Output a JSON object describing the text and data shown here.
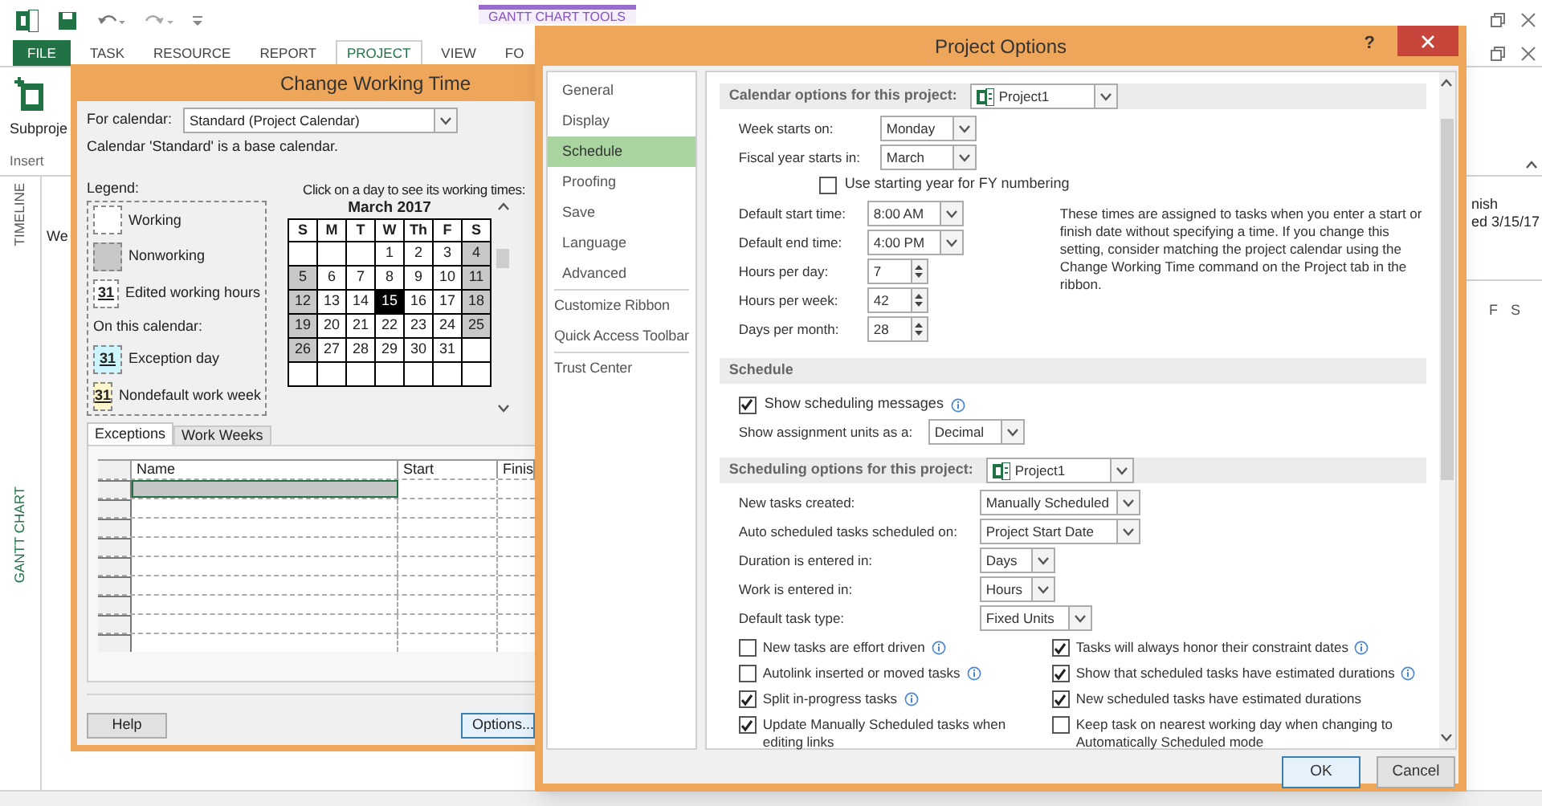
{
  "app": {
    "contextual_tab": "GANTT CHART TOOLS",
    "tabs": [
      {
        "label": "FILE",
        "kind": "file",
        "selected": false
      },
      {
        "label": "TASK",
        "kind": "tab",
        "selected": false
      },
      {
        "label": "RESOURCE",
        "kind": "tab",
        "selected": false
      },
      {
        "label": "REPORT",
        "kind": "tab",
        "selected": false
      },
      {
        "label": "PROJECT",
        "kind": "tab",
        "selected": true
      },
      {
        "label": "VIEW",
        "kind": "tab",
        "selected": false
      },
      {
        "label": "FO",
        "kind": "tab",
        "selected": false
      }
    ],
    "ribbon": {
      "button": "Subproje",
      "group": "Insert"
    },
    "timeline": {
      "label": "TIMELINE",
      "text": "We"
    },
    "view_bar": {
      "label": "GANTT CHART"
    },
    "right_pane": {
      "texts": [
        "nish",
        "ed 3/15/17"
      ],
      "day_headers": [
        "F",
        "S"
      ]
    }
  },
  "change_working_time": {
    "title": "Change Working Time",
    "calendar_label": "For calendar:",
    "calendar_value": "Standard (Project Calendar)",
    "note": "Calendar 'Standard' is a base calendar.",
    "legend_title": "Legend:",
    "legend": [
      {
        "kind": "working",
        "label": "Working"
      },
      {
        "kind": "nonworking",
        "label": "Nonworking"
      },
      {
        "kind": "edited",
        "sample": "31",
        "label": "Edited working hours"
      },
      {
        "kind": "heading",
        "label": "On this calendar:"
      },
      {
        "kind": "exception",
        "sample": "31",
        "label": "Exception day"
      },
      {
        "kind": "nondefault",
        "sample": "31",
        "label": "Nondefault work week"
      }
    ],
    "calendar_hint": "Click on a day to see its working times:",
    "month": "March 2017",
    "weekdays": [
      "S",
      "M",
      "T",
      "W",
      "Th",
      "F",
      "S"
    ],
    "weeks": [
      [
        {
          "kind": "blank",
          "selected": false
        },
        {
          "kind": "blank",
          "selected": false
        },
        {
          "kind": "blank",
          "selected": false
        },
        {
          "day": "1",
          "kind": "working",
          "selected": false
        },
        {
          "day": "2",
          "kind": "working",
          "selected": false
        },
        {
          "day": "3",
          "kind": "working",
          "selected": false
        },
        {
          "day": "4",
          "kind": "nonworking",
          "selected": false
        }
      ],
      [
        {
          "day": "5",
          "kind": "nonworking",
          "selected": false
        },
        {
          "day": "6",
          "kind": "working",
          "selected": false
        },
        {
          "day": "7",
          "kind": "working",
          "selected": false
        },
        {
          "day": "8",
          "kind": "working",
          "selected": false
        },
        {
          "day": "9",
          "kind": "working",
          "selected": false
        },
        {
          "day": "10",
          "kind": "working",
          "selected": false
        },
        {
          "day": "11",
          "kind": "nonworking",
          "selected": false
        }
      ],
      [
        {
          "day": "12",
          "kind": "nonworking",
          "selected": false
        },
        {
          "day": "13",
          "kind": "working",
          "selected": false
        },
        {
          "day": "14",
          "kind": "working",
          "selected": false
        },
        {
          "day": "15",
          "kind": "working",
          "selected": true
        },
        {
          "day": "16",
          "kind": "working",
          "selected": false
        },
        {
          "day": "17",
          "kind": "working",
          "selected": false
        },
        {
          "day": "18",
          "kind": "nonworking",
          "selected": false
        }
      ],
      [
        {
          "day": "19",
          "kind": "nonworking",
          "selected": false
        },
        {
          "day": "20",
          "kind": "working",
          "selected": false
        },
        {
          "day": "21",
          "kind": "working",
          "selected": false
        },
        {
          "day": "22",
          "kind": "working",
          "selected": false
        },
        {
          "day": "23",
          "kind": "working",
          "selected": false
        },
        {
          "day": "24",
          "kind": "working",
          "selected": false
        },
        {
          "day": "25",
          "kind": "nonworking",
          "selected": false
        }
      ],
      [
        {
          "day": "26",
          "kind": "nonworking",
          "selected": false
        },
        {
          "day": "27",
          "kind": "working",
          "selected": false
        },
        {
          "day": "28",
          "kind": "working",
          "selected": false
        },
        {
          "day": "29",
          "kind": "working",
          "selected": false
        },
        {
          "day": "30",
          "kind": "working",
          "selected": false
        },
        {
          "day": "31",
          "kind": "working",
          "selected": false
        },
        {
          "kind": "blank",
          "selected": false
        }
      ],
      [
        {
          "kind": "blank",
          "selected": false
        },
        {
          "kind": "blank",
          "selected": false
        },
        {
          "kind": "blank",
          "selected": false
        },
        {
          "kind": "blank",
          "selected": false
        },
        {
          "kind": "blank",
          "selected": false
        },
        {
          "kind": "blank",
          "selected": false
        },
        {
          "kind": "blank",
          "selected": false
        }
      ]
    ],
    "tabs": [
      {
        "label": "Exceptions",
        "selected": true
      },
      {
        "label": "Work Weeks",
        "selected": false
      }
    ],
    "columns": [
      "Name",
      "Start",
      "Finis"
    ],
    "rows": [
      {
        "selected": true
      },
      {
        "selected": false
      },
      {
        "selected": false
      },
      {
        "selected": false
      },
      {
        "selected": false
      },
      {
        "selected": false
      },
      {
        "selected": false
      },
      {
        "selected": false
      },
      {
        "selected": false
      }
    ],
    "buttons": [
      {
        "label": "Help",
        "focused": false
      },
      {
        "label": "Options...",
        "focused": true
      }
    ]
  },
  "project_options": {
    "title": "Project Options",
    "help": "?",
    "nav": [
      [
        {
          "label": "General",
          "selected": false
        },
        {
          "label": "Display",
          "selected": false
        },
        {
          "label": "Schedule",
          "selected": true
        },
        {
          "label": "Proofing",
          "selected": false
        },
        {
          "label": "Save",
          "selected": false
        },
        {
          "label": "Language",
          "selected": false
        },
        {
          "label": "Advanced",
          "selected": false
        }
      ],
      [
        {
          "label": "Customize Ribbon",
          "selected": false
        },
        {
          "label": "Quick Access Toolbar",
          "selected": false
        }
      ],
      [
        {
          "label": "Trust Center",
          "selected": false
        }
      ]
    ],
    "calendar_options": {
      "title": "Calendar options for this project:",
      "project": "Project1",
      "rows": [
        {
          "kind": "select",
          "label": "Week starts on:",
          "value": "Monday"
        },
        {
          "kind": "select",
          "label": "Fiscal year starts in:",
          "value": "March"
        },
        {
          "kind": "checkbox",
          "label": "Use starting year for FY numbering",
          "checked": false,
          "info": false
        },
        {
          "kind": "select",
          "label": "Default start time:",
          "value": "8:00 AM"
        },
        {
          "kind": "select",
          "label": "Default end time:",
          "value": "4:00 PM"
        },
        {
          "kind": "spin",
          "label": "Hours per day:",
          "value": "7"
        },
        {
          "kind": "spin",
          "label": "Hours per week:",
          "value": "42"
        },
        {
          "kind": "spin",
          "label": "Days per month:",
          "value": "28"
        }
      ],
      "note": "These times are assigned to tasks when you enter a start or finish date without specifying a time. If you change this setting, consider matching the project calendar using the Change Working Time command on the Project tab in the ribbon."
    },
    "schedule": {
      "title": "Schedule",
      "rows": [
        {
          "kind": "checkbox",
          "label": "Show scheduling messages",
          "checked": true,
          "info": true
        },
        {
          "kind": "select",
          "label": "Show assignment units as a:",
          "value": "Decimal"
        }
      ]
    },
    "scheduling_options": {
      "title": "Scheduling options for this project:",
      "project": "Project1",
      "rows": [
        {
          "kind": "select",
          "label": "New tasks created:",
          "value": "Manually Scheduled"
        },
        {
          "kind": "select",
          "label": "Auto scheduled tasks scheduled on:",
          "value": "Project Start Date"
        },
        {
          "kind": "select",
          "label": "Duration is entered in:",
          "value": "Days"
        },
        {
          "kind": "select",
          "label": "Work is entered in:",
          "value": "Hours"
        },
        {
          "kind": "select",
          "label": "Default task type:",
          "value": "Fixed Units"
        }
      ],
      "checks": [
        {
          "label": "New tasks are effort driven",
          "checked": false,
          "info": true
        },
        {
          "label": "Tasks will always honor their constraint dates",
          "checked": true,
          "info": true
        },
        {
          "label": "Autolink inserted or moved tasks",
          "checked": false,
          "info": true
        },
        {
          "label": "Show that scheduled tasks have estimated durations",
          "checked": true,
          "info": true
        },
        {
          "label": "Split in-progress tasks",
          "checked": true,
          "info": true
        },
        {
          "label": "New scheduled tasks have estimated durations",
          "checked": true,
          "info": false
        },
        {
          "label": "Update Manually Scheduled tasks when editing links",
          "checked": true,
          "info": false
        },
        {
          "label": "Keep task on nearest working day when changing to Automatically Scheduled mode",
          "checked": false,
          "info": false
        }
      ]
    },
    "buttons": [
      {
        "label": "OK",
        "focused": true
      },
      {
        "label": "Cancel",
        "focused": false
      }
    ]
  }
}
